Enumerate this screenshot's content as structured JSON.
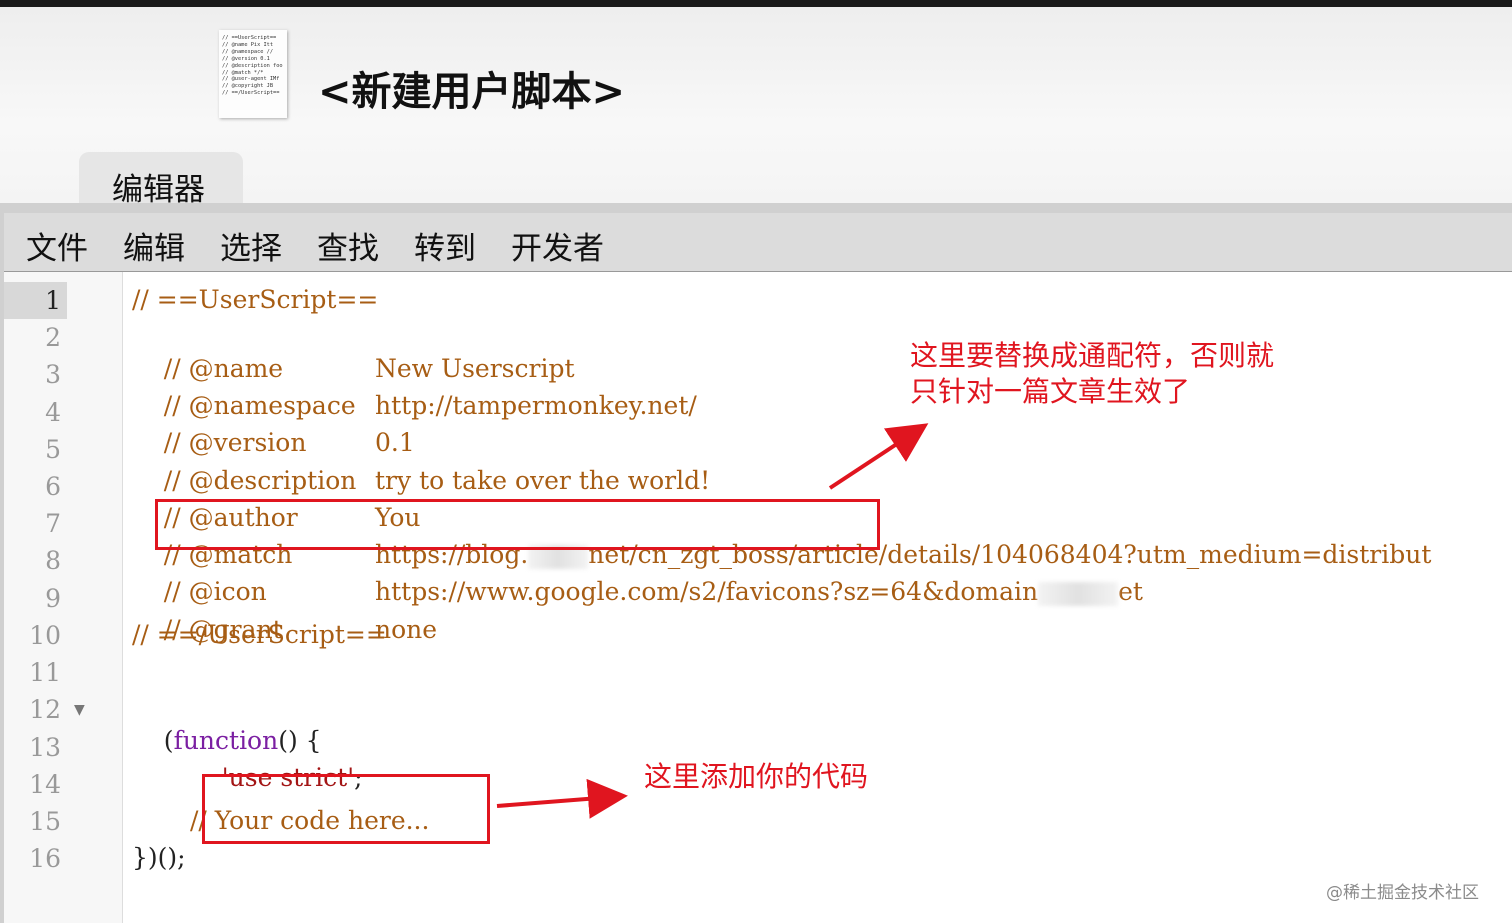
{
  "header": {
    "title": "<新建用户脚本>",
    "icon_lines": [
      "// ==UserScript==",
      "// @name  Pix Itt",
      "// @namespace  //",
      "// @version  0.1",
      "// @description  foo",
      "// @match  */*",
      "// @user-agent IMf",
      "// @copyright  JB",
      "// ==/UserScript=="
    ]
  },
  "tabs": [
    {
      "label": "编辑器"
    }
  ],
  "menu": {
    "items": [
      "文件",
      "编辑",
      "选择",
      "查找",
      "转到",
      "开发者"
    ]
  },
  "editor": {
    "active_line": 1,
    "line_numbers": [
      "1",
      "2",
      "3",
      "4",
      "5",
      "6",
      "7",
      "8",
      "9",
      "10",
      "11",
      "12",
      "13",
      "14",
      "15",
      "16"
    ],
    "lines": {
      "l1": "// ==UserScript==",
      "l2_key": "// @name",
      "l2_val": "New Userscript",
      "l3_key": "// @namespace",
      "l3_val": "http://tampermonkey.net/",
      "l4_key": "// @version",
      "l4_val": "0.1",
      "l5_key": "// @description",
      "l5_val": "try to take over the world!",
      "l6_key": "// @author",
      "l6_val": "You",
      "l7_key": "// @match",
      "l7_val_a": "https://blog.",
      "l7_val_b": "net/cn_zgt_boss/article/details/104068404?utm_medium=distribut",
      "l8_key": "// @icon",
      "l8_val_a": "https://www.google.com/s2/favicons?sz=64&domain",
      "l8_val_b": "et",
      "l9_key": "// @grant",
      "l9_val": "none",
      "l10": "// ==/UserScript==",
      "l12_a": "(",
      "l12_kw": "function",
      "l12_b": "() {",
      "l13_str": "'use strict'",
      "l13_b": ";",
      "l15": "// Your code here...",
      "l16": "})();"
    }
  },
  "annotations": {
    "note1_line1": "这里要替换成通配符，否则就",
    "note1_line2": "只针对一篇文章生效了",
    "note2": "这里添加你的代码",
    "color": "#e0151f"
  },
  "watermark": "@稀土掘金技术社区"
}
